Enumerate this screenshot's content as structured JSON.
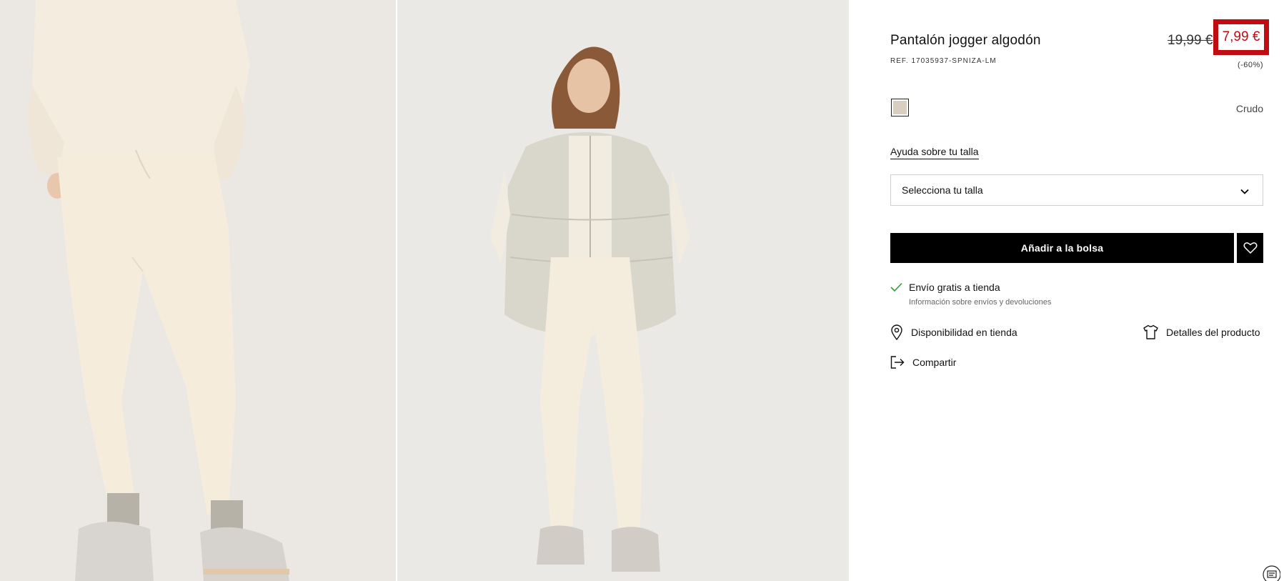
{
  "product": {
    "title": "Pantalón jogger algodón",
    "ref": "REF. 17035937-SPNIZA-LM",
    "price_old": "19,99 €",
    "price_new": "7,99 €",
    "discount": "(-60%)",
    "color_name": "Crudo",
    "swatch_color": "#d9cfc1"
  },
  "size": {
    "help_label": "Ayuda sobre tu talla",
    "select_placeholder": "Selecciona tu talla"
  },
  "actions": {
    "add_to_bag": "Añadir a la bolsa"
  },
  "shipping": {
    "label": "Envío gratis a tienda",
    "info": "Información sobre envíos y devoluciones"
  },
  "links": {
    "store_availability": "Disponibilidad en tienda",
    "product_details": "Detalles del producto",
    "share": "Compartir"
  },
  "colors": {
    "sale_red": "#c10c12",
    "check_green": "#2e9e3e",
    "photo_bg": "#ebe9e6"
  },
  "icons": {
    "favorite": "heart-icon",
    "check": "check-icon",
    "location": "location-pin-icon",
    "details": "tshirt-icon",
    "share": "share-icon",
    "dropdown": "chevron-down-icon",
    "chat": "chat-icon"
  }
}
